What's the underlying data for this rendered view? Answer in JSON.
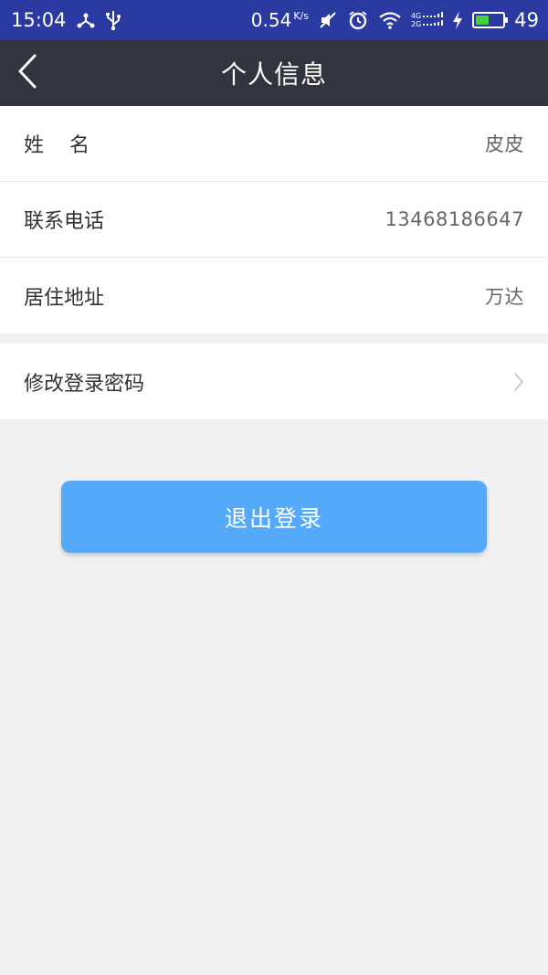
{
  "status_bar": {
    "time": "15:04",
    "speed": "0.54",
    "speed_unit": "K/s",
    "network_top": "4G",
    "network_bottom": "2G",
    "battery_level": "49",
    "icons": [
      "share-icon",
      "usb-icon",
      "mute-icon",
      "alarm-icon",
      "wifi-icon",
      "signal-icon",
      "charging-icon",
      "battery-icon"
    ]
  },
  "nav": {
    "title": "个人信息",
    "back_icon": "chevron-left-icon"
  },
  "profile": {
    "name_label": "姓名",
    "name_value": "皮皮",
    "phone_label": "联系电话",
    "phone_value": "13468186647",
    "address_label": "居住地址",
    "address_value": "万达"
  },
  "settings": {
    "change_password_label": "修改登录密码",
    "chevron_icon": "chevron-right-icon"
  },
  "logout": {
    "label": "退出登录"
  },
  "colors": {
    "status_bar": "#2b3aa0",
    "nav_bar": "#32353d",
    "background": "#f0f0f0",
    "button": "#54a9f8",
    "battery": "#3fd23f"
  }
}
